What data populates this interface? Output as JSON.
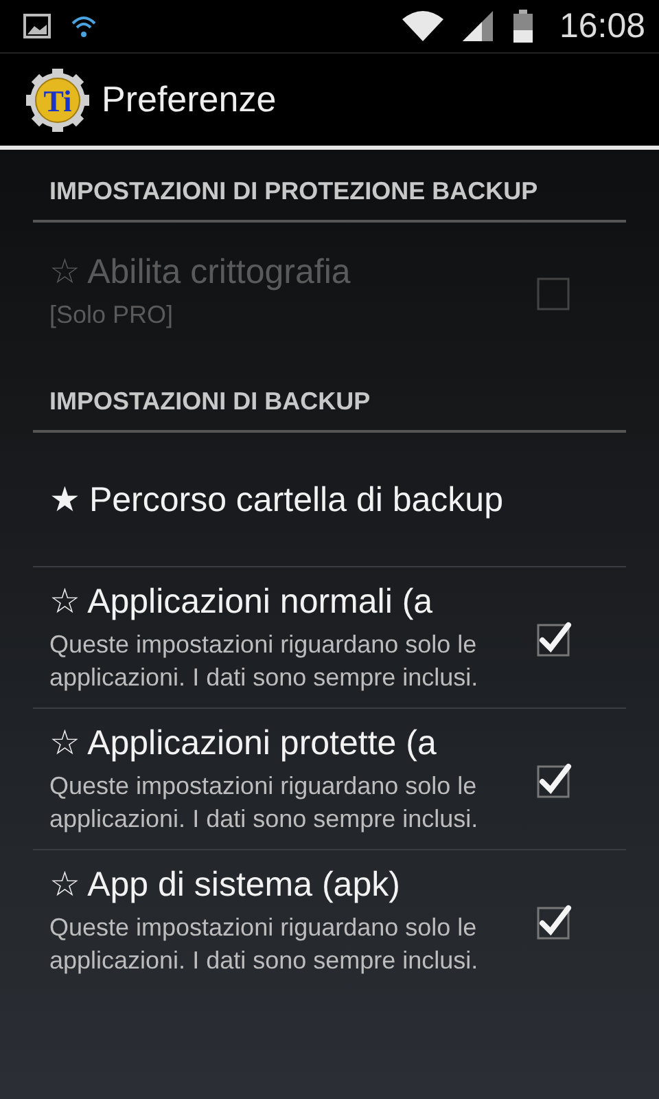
{
  "status_bar": {
    "time": "16:08"
  },
  "action_bar": {
    "logo_text": "Ti",
    "title": "Preferenze"
  },
  "sections": [
    {
      "header": "IMPOSTAZIONI DI PROTEZIONE BACKUP",
      "items": [
        {
          "kind": "checkbox",
          "title": "☆ Abilita crittografia",
          "summary": "[Solo PRO]",
          "checked": false,
          "disabled": true
        }
      ]
    },
    {
      "header": "IMPOSTAZIONI DI BACKUP",
      "items": [
        {
          "kind": "plain",
          "title": "★ Percorso cartella di backup",
          "disabled": false
        },
        {
          "kind": "checkbox",
          "title": "☆ Applicazioni normali (a",
          "summary": "Queste impostazioni riguardano solo le applicazioni. I dati sono sempre inclusi.",
          "checked": true,
          "disabled": false
        },
        {
          "kind": "checkbox",
          "title": "☆ Applicazioni protette (a",
          "summary": "Queste impostazioni riguardano solo le applicazioni. I dati sono sempre inclusi.",
          "checked": true,
          "disabled": false
        },
        {
          "kind": "checkbox",
          "title": "☆ App di sistema (apk)",
          "summary": "Queste impostazioni riguardano solo le applicazioni. I dati sono sempre inclusi.",
          "checked": true,
          "disabled": false
        }
      ]
    }
  ]
}
